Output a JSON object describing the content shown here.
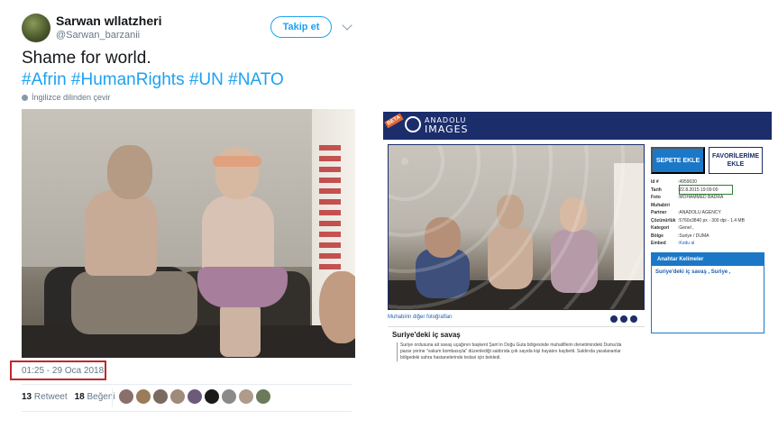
{
  "tweet": {
    "display_name": "Sarwan wllatzheri",
    "handle": "@Sarwan_barzanii",
    "follow_label": "Takip et",
    "text_line1": "Shame for world.",
    "hashtags": "#Afrin #HumanRights #UN #NATO",
    "translate_label": "İngilizce dilinden çevir",
    "timestamp": "01:25 - 29 Oca 2018",
    "retweet_count": "13",
    "retweet_label": "Retweet",
    "like_count": "18",
    "like_label": "Beğeni",
    "likers": [
      "#8a6f6a",
      "#9a7b5a",
      "#7a6a60",
      "#a08a7a",
      "#6b5a7a",
      "#1a1a1a",
      "#8a8a8a",
      "#b09a8a",
      "#6a7a5a"
    ]
  },
  "highlight_color": "#c1272d",
  "anadolu": {
    "beta": "BETA",
    "brand_line1": "ANADOLU",
    "brand_line2": "IMAGES",
    "nav_arrows": "‹ ›",
    "cart_button": "SEPETE EKLE",
    "favorites_button": "FAVORİLERİME EKLE",
    "meta": [
      {
        "key": "Id #",
        "value": "4959030"
      },
      {
        "key": "Tarih",
        "value": "22.8.2015 19:09:00"
      },
      {
        "key": "Foto Muhabiri",
        "value": "MOHAMMED BADRA"
      },
      {
        "key": "Partner",
        "value": "ANADOLU AGENCY"
      },
      {
        "key": "Çözünürlük",
        "value": "5760x3840 px - 300 dpi - 1.4 MB"
      },
      {
        "key": "Kategori",
        "value": "Genel ,"
      },
      {
        "key": "Bölge",
        "value": "Suriye / DUMA"
      },
      {
        "key": "Embed",
        "value": "Kodu al"
      }
    ],
    "other_photos_link": "Muhabirin diğer fotoğrafları",
    "section_title": "Suriye'deki iç savaş",
    "section_body": "Suriye ordusuna ait savaş uçağının başkent Şam'ın Doğu Guta bölgesinde muhaliflerin denetimindeki Duma'da pazar yerine \"vakum bombasıyla\" düzenlediği saldırıda çok sayıda kişi hayatını kaybetti. Saldırıda yaralananlar bölgedeki sahra hastanelerinde tedavi için bekledi.",
    "keywords_title": "Anahtar Kelimeler",
    "keywords": "Suriye'deki iç savaş , Suriye ,",
    "date_highlight_color": "#2e7d32"
  }
}
